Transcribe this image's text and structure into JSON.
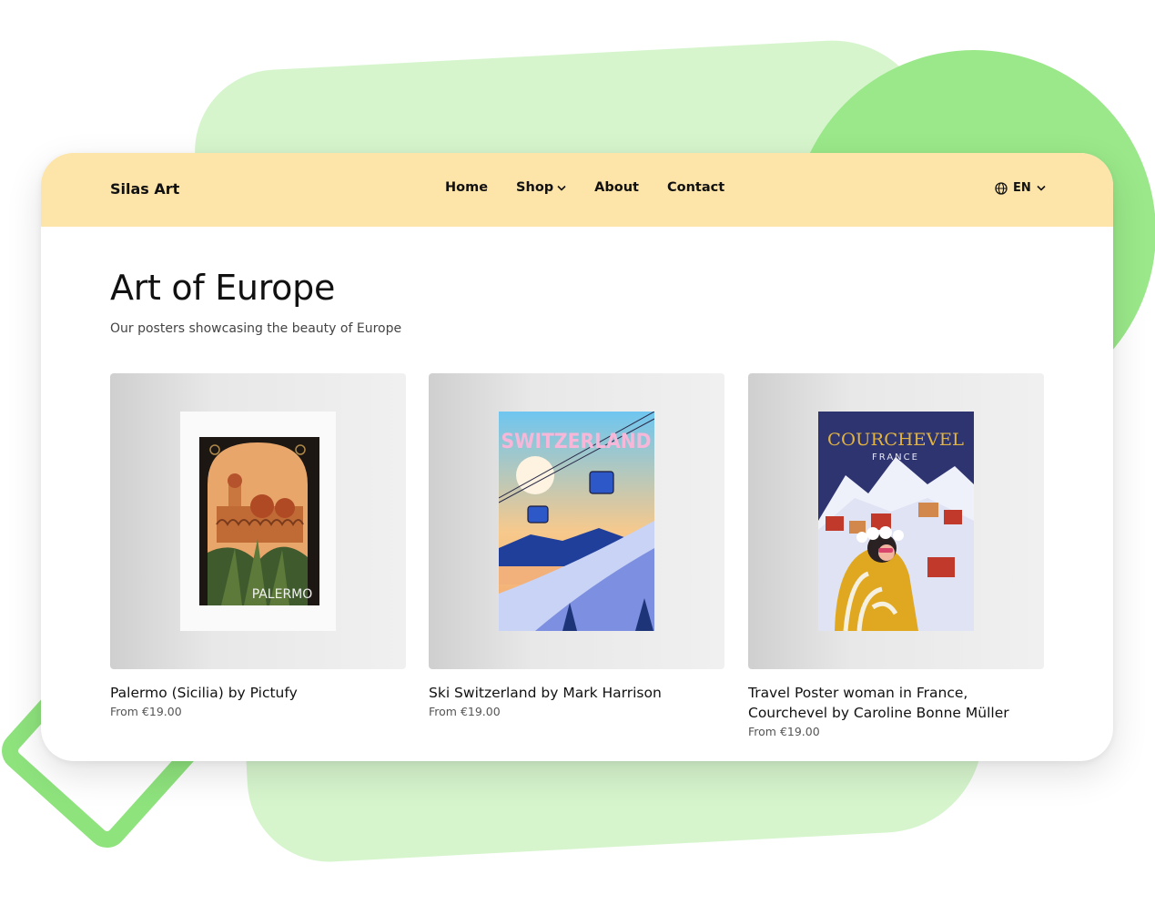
{
  "navbar": {
    "brand": "Silas Art",
    "links": [
      {
        "label": "Home"
      },
      {
        "label": "Shop"
      },
      {
        "label": "About"
      },
      {
        "label": "Contact"
      }
    ],
    "language": "EN"
  },
  "page": {
    "title": "Art of Europe",
    "subtitle": "Our posters showcasing the beauty of Europe"
  },
  "products": [
    {
      "title": "Palermo (Sicilia) by Pictufy",
      "price": "From €19.00",
      "poster_text": "PALERMO"
    },
    {
      "title": "Ski Switzerland by Mark Harrison",
      "price": "From €19.00",
      "poster_text": "SWITZERLAND"
    },
    {
      "title": "Travel Poster woman in France, Courchevel by Caroline Bonne Müller",
      "price": "From €19.00",
      "poster_text": "COURCHEVEL",
      "poster_subtext": "FRANCE"
    }
  ],
  "colors": {
    "navbar_bg": "#fde4a8",
    "deco_green_light": "#d6f5cd",
    "deco_green": "#9ae889"
  }
}
